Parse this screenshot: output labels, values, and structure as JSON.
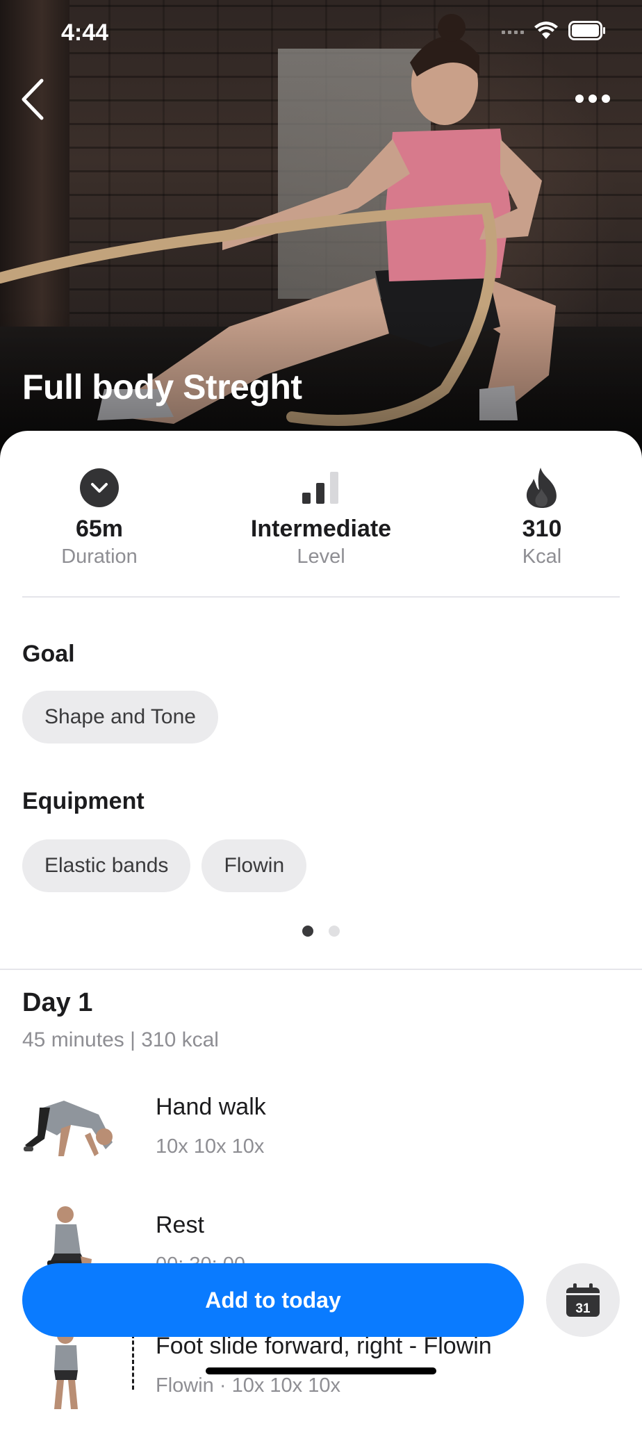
{
  "status_bar": {
    "time": "4:44"
  },
  "hero": {
    "title": "Full body Streght"
  },
  "stats": [
    {
      "value": "65m",
      "label": "Duration",
      "icon": "clock-icon"
    },
    {
      "value": "Intermediate",
      "label": "Level",
      "icon": "level-bars-icon"
    },
    {
      "value": "310",
      "label": "Kcal",
      "icon": "flame-icon"
    }
  ],
  "goal": {
    "title": "Goal",
    "chips": [
      "Shape and Tone"
    ]
  },
  "equipment": {
    "title": "Equipment",
    "chips": [
      "Elastic bands",
      "Flowin"
    ]
  },
  "pager": {
    "count": 2,
    "active": 0
  },
  "day": {
    "title": "Day 1",
    "subtitle": "45 minutes | 310 kcal",
    "exercises": [
      {
        "name": "Hand walk",
        "reps": "10x 10x 10x"
      },
      {
        "name": "Rest",
        "reps": "00: 30: 00"
      },
      {
        "name": "Foot slide forward, right - Flowin",
        "reps": "Flowin · 10x 10x 10x"
      }
    ]
  },
  "cta": {
    "label": "Add to today"
  },
  "calendar_button": {
    "day": "31"
  },
  "colors": {
    "accent": "#0a7bff",
    "chip_bg": "#ebebed",
    "muted_text": "#8e8e93"
  }
}
